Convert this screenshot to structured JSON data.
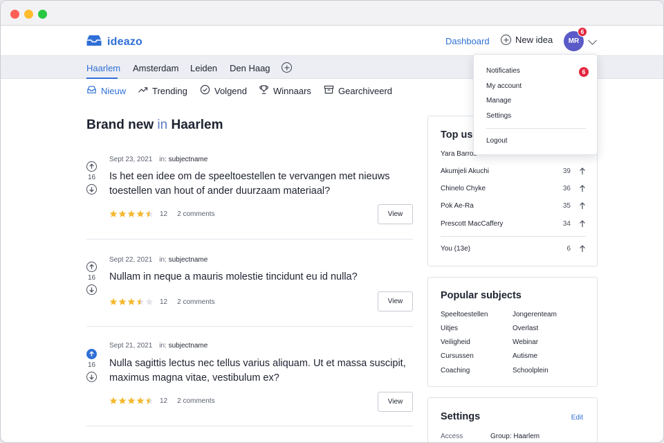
{
  "app": {
    "name": "ideazo"
  },
  "nav": {
    "dashboard": "Dashboard",
    "new_idea": "New idea",
    "avatar_initials": "MR",
    "notification_count": "6"
  },
  "cities": [
    "Haarlem",
    "Amsterdam",
    "Leiden",
    "Den Haag"
  ],
  "filters": [
    {
      "label": "Nieuw",
      "icon": "inbox-icon",
      "active": true
    },
    {
      "label": "Trending",
      "icon": "trending-icon",
      "active": false
    },
    {
      "label": "Volgend",
      "icon": "check-circle-icon",
      "active": false
    },
    {
      "label": "Winnaars",
      "icon": "trophy-icon",
      "active": false
    },
    {
      "label": "Gearchiveerd",
      "icon": "archive-icon",
      "active": false
    }
  ],
  "heading": {
    "prefix": "Brand new",
    "in": "in",
    "city": "Haarlem"
  },
  "posts": [
    {
      "date": "Sept 23, 2021",
      "in_label": "in:",
      "subject": "subjectname",
      "title": "Is het een idee om de speeltoestellen te vervangen met nieuws toestellen van hout of ander duurzaam materiaal?",
      "votes": "16",
      "upvoted": false,
      "rating": 4.5,
      "rating_count": "12",
      "comments": "2 comments",
      "view_label": "View"
    },
    {
      "date": "Sept 22, 2021",
      "in_label": "in:",
      "subject": "subjectname",
      "title": "Nullam in neque a mauris molestie tincidunt eu id nulla?",
      "votes": "16",
      "upvoted": false,
      "rating": 3.5,
      "rating_count": "12",
      "comments": "2 comments",
      "view_label": "View"
    },
    {
      "date": "Sept 21, 2021",
      "in_label": "in:",
      "subject": "subjectname",
      "title": "Nulla sagittis lectus nec tellus varius aliquam. Ut et massa suscipit, maximus magna vitae, vestibulum ex?",
      "votes": "16",
      "upvoted": true,
      "rating": 4.5,
      "rating_count": "12",
      "comments": "2 comments",
      "view_label": "View"
    }
  ],
  "top_users": {
    "title": "Top use",
    "users": [
      {
        "name": "Yara Barros",
        "score": ""
      },
      {
        "name": "Akumjeli Akuchi",
        "score": "39"
      },
      {
        "name": "Chinelo Chyke",
        "score": "36"
      },
      {
        "name": "Pok Ae-Ra",
        "score": "35"
      },
      {
        "name": "Prescott MacCaffery",
        "score": "34"
      }
    ],
    "you": {
      "name": "You (13e)",
      "score": "6"
    }
  },
  "popular_subjects": {
    "title": "Popular subjects",
    "col1": [
      "Speeltoestellen",
      "Uitjes",
      "Veiligheid",
      "Cursussen",
      "Coaching"
    ],
    "col2": [
      "Jongerenteam",
      "Overlast",
      "Webinar",
      "Autisme",
      "Schoolplein"
    ]
  },
  "settings": {
    "title": "Settings",
    "edit": "Edit",
    "access_label": "Access",
    "access_value": "Group: Haarlem"
  },
  "dropdown": {
    "items": [
      "Notificaties",
      "My account",
      "Manage",
      "Settings"
    ],
    "logout": "Logout",
    "badge": "6"
  },
  "colors": {
    "accent": "#2f6fd6",
    "badge": "#e3263d",
    "star": "#f5b82e",
    "avatar": "#5a5ac9"
  }
}
